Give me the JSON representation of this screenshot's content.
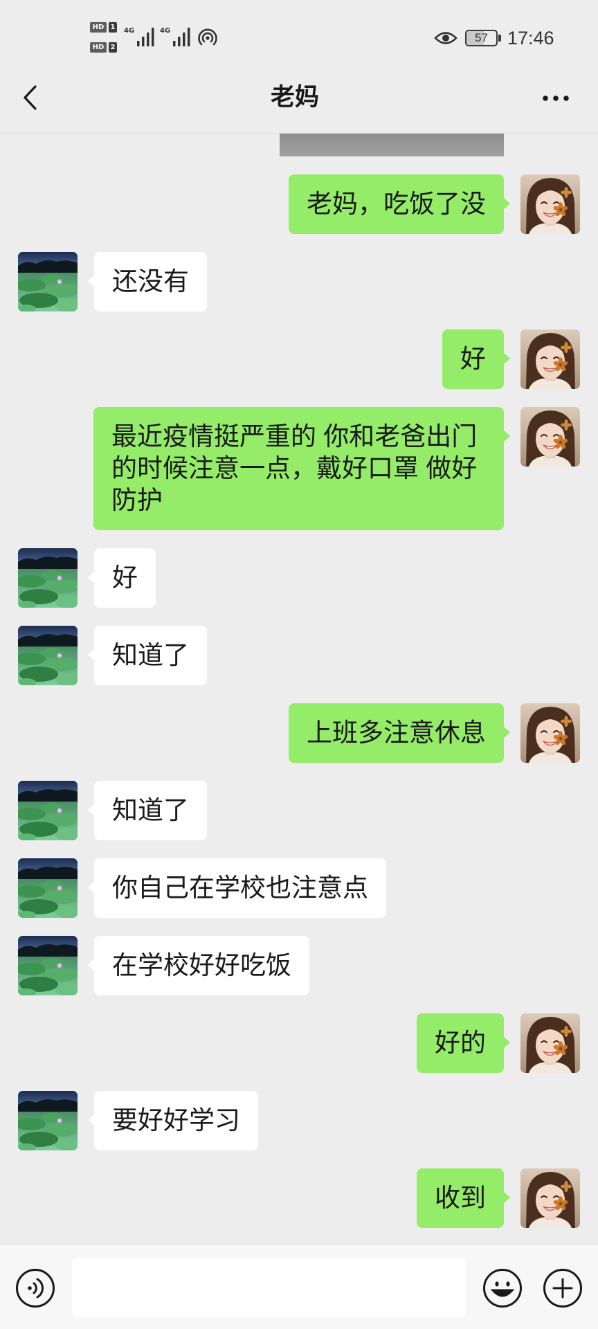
{
  "status_bar": {
    "sim1": {
      "badge": "HD",
      "slot": "1"
    },
    "sim2": {
      "badge": "HD",
      "slot": "2"
    },
    "network1": "4G",
    "network2": "4G",
    "signal_icon": "signal-icon",
    "hotspot_icon": "hotspot-icon",
    "eye_icon": "eye-icon",
    "battery": "57",
    "time": "17:46"
  },
  "header": {
    "title": "老妈",
    "back_icon": "chevron-left-icon",
    "more_icon": "more-icon"
  },
  "messages": [
    {
      "outgoing": true,
      "text": "老妈，吃饭了没"
    },
    {
      "outgoing": false,
      "text": "还没有"
    },
    {
      "outgoing": true,
      "text": "好"
    },
    {
      "outgoing": true,
      "text": "最近疫情挺严重的 你和老爸出门的时候注意一点，戴好口罩 做好防护"
    },
    {
      "outgoing": false,
      "text": "好"
    },
    {
      "outgoing": false,
      "text": "知道了"
    },
    {
      "outgoing": true,
      "text": "上班多注意休息"
    },
    {
      "outgoing": false,
      "text": "知道了"
    },
    {
      "outgoing": false,
      "text": "你自己在学校也注意点"
    },
    {
      "outgoing": false,
      "text": "在学校好好吃饭"
    },
    {
      "outgoing": true,
      "text": "好的"
    },
    {
      "outgoing": false,
      "text": "要好好学习"
    },
    {
      "outgoing": true,
      "text": "收到"
    }
  ],
  "input_bar": {
    "value": "",
    "voice_icon": "voice-icon",
    "emoji_icon": "emoji-icon",
    "plus_icon": "plus-icon"
  },
  "colors": {
    "background": "#ededed",
    "outgoing_bubble": "#95ec69",
    "incoming_bubble": "#ffffff",
    "input_bar": "#f7f7f7"
  }
}
